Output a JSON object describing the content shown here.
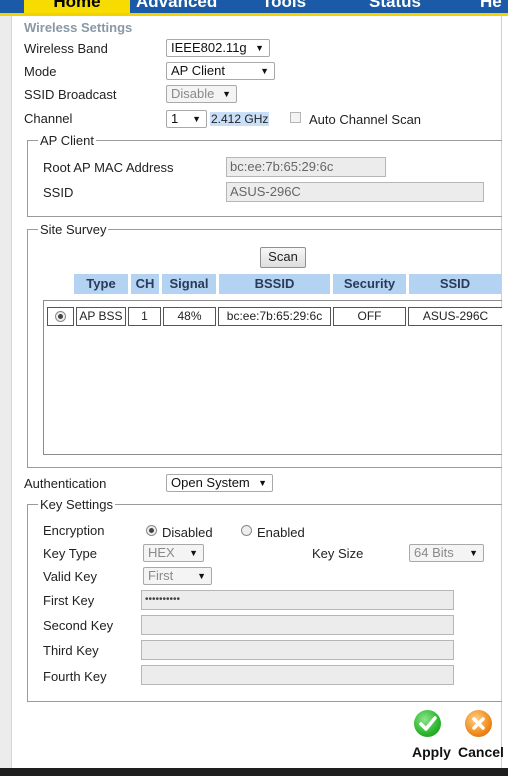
{
  "tabs": [
    {
      "label": "Home"
    },
    {
      "label": "Advanced"
    },
    {
      "label": "Tools"
    },
    {
      "label": "Status"
    },
    {
      "label": "He"
    }
  ],
  "wireless": {
    "heading": "Wireless Settings",
    "band_label": "Wireless Band",
    "band_value": "IEEE802.11g",
    "mode_label": "Mode",
    "mode_value": "AP Client",
    "ssid_broadcast_label": "SSID Broadcast",
    "ssid_broadcast_value": "Disable",
    "channel_label": "Channel",
    "channel_value": "1",
    "channel_freq": "2.412 GHz",
    "auto_scan_label": "Auto Channel Scan"
  },
  "ap_client": {
    "legend": "AP Client",
    "root_mac_label": "Root AP MAC Address",
    "root_mac_value": "bc:ee:7b:65:29:6c",
    "ssid_label": "SSID",
    "ssid_value": "ASUS-296C"
  },
  "site_survey": {
    "legend": "Site Survey",
    "scan_label": "Scan",
    "columns": [
      "Type",
      "CH",
      "Signal",
      "BSSID",
      "Security",
      "SSID"
    ],
    "rows": [
      {
        "type": "AP BSS",
        "ch": "1",
        "signal": "48%",
        "bssid": "bc:ee:7b:65:29:6c",
        "security": "OFF",
        "ssid": "ASUS-296C"
      }
    ]
  },
  "auth": {
    "label": "Authentication",
    "value": "Open System"
  },
  "key_settings": {
    "legend": "Key Settings",
    "encryption_label": "Encryption",
    "disabled_label": "Disabled",
    "enabled_label": "Enabled",
    "key_type_label": "Key Type",
    "key_type_value": "HEX",
    "key_size_label": "Key Size",
    "key_size_value": "64 Bits",
    "valid_key_label": "Valid Key",
    "valid_key_value": "First",
    "first_key_label": "First Key",
    "first_key_value": "••••••••••",
    "second_key_label": "Second Key",
    "third_key_label": "Third Key",
    "fourth_key_label": "Fourth Key"
  },
  "actions": {
    "apply_label": "Apply",
    "cancel_label": "Cancel"
  },
  "colors": {
    "tab_bar": "#1a5aa6",
    "tab_active": "#f6dc00",
    "header_cell": "#b4d3f2",
    "apply_green": "#2bb52b",
    "cancel_orange": "#f08a1a"
  }
}
